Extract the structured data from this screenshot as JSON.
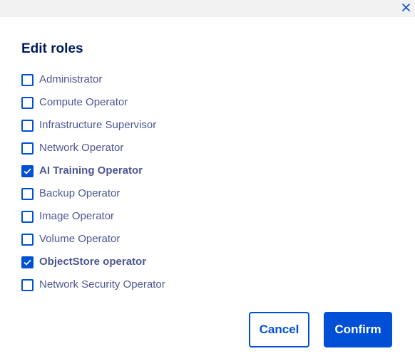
{
  "dialog": {
    "title": "Edit roles",
    "close_icon": "close-icon"
  },
  "roles": [
    {
      "label": "Administrator",
      "checked": false
    },
    {
      "label": "Compute Operator",
      "checked": false
    },
    {
      "label": "Infrastructure Supervisor",
      "checked": false
    },
    {
      "label": "Network Operator",
      "checked": false
    },
    {
      "label": "AI Training Operator",
      "checked": true
    },
    {
      "label": "Backup Operator",
      "checked": false
    },
    {
      "label": "Image Operator",
      "checked": false
    },
    {
      "label": "Volume Operator",
      "checked": false
    },
    {
      "label": "ObjectStore operator",
      "checked": true
    },
    {
      "label": "Network Security Operator",
      "checked": false
    }
  ],
  "actions": {
    "cancel_label": "Cancel",
    "confirm_label": "Confirm"
  },
  "colors": {
    "primary": "#0050d7",
    "title": "#00185e",
    "label": "#4d5693",
    "topbar": "#f2f2f2"
  }
}
